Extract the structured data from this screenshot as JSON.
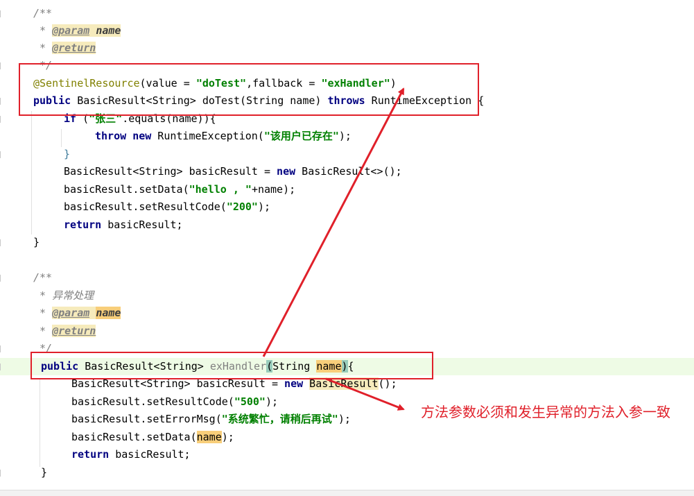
{
  "editor": {
    "lines": {
      "l1": {
        "a": "/**"
      },
      "l2": {
        "a": " * ",
        "tag": "@param",
        "sp": " ",
        "name": "name"
      },
      "l3": {
        "a": " * ",
        "tag": "@return"
      },
      "l4": {
        "a": " */"
      },
      "l5": {
        "ann": "@SentinelResource",
        "p1": "(value = ",
        "s1": "\"doTest\"",
        "p2": ",fallback = ",
        "s2": "\"exHandler\"",
        "p3": ")"
      },
      "l6": {
        "k1": "public",
        "t1": " BasicResult<String> doTest(String name) ",
        "k2": "throws",
        "t2": " RuntimeException {"
      },
      "l7": {
        "k1": "if",
        "t1": " (",
        "s1": "\"张三\"",
        "t2": ".equals(name)){"
      },
      "l8": {
        "k1": "throw",
        "sp": " ",
        "k2": "new",
        "t1": " RuntimeException(",
        "s1": "\"该用户已存在\"",
        "t2": ");"
      },
      "l9": {
        "t1": "}"
      },
      "l10": {
        "t1": "BasicResult<String> basicResult = ",
        "k1": "new",
        "t2": " BasicResult<>();"
      },
      "l11": {
        "t1": "basicResult.setData(",
        "s1": "\"hello , \"",
        "t2": "+name);"
      },
      "l12": {
        "t1": "basicResult.setResultCode(",
        "s1": "\"200\"",
        "t2": ");"
      },
      "l13": {
        "k1": "return",
        "t1": " basicResult;"
      },
      "l14": {
        "t1": "}"
      },
      "l16": {
        "a": "/**"
      },
      "l17": {
        "a": " * 异常处理"
      },
      "l18": {
        "a": " * ",
        "tag": "@param",
        "sp": " ",
        "name": "name"
      },
      "l19": {
        "a": " * ",
        "tag": "@return"
      },
      "l20": {
        "a": " */"
      },
      "l21": {
        "k1": "public",
        "t1": " BasicResult<String> ",
        "fn": "exHandler",
        "b1": "(",
        "t2": "String ",
        "p": "name",
        "b2": ")",
        "t3": "{"
      },
      "l22": {
        "t1": "BasicResult<String> basicResult = ",
        "k1": "new",
        "sp": " ",
        "t2": "BasicResult",
        "t3": "();"
      },
      "l23": {
        "t1": "basicResult.setResultCode(",
        "s1": "\"500\"",
        "t2": ");"
      },
      "l24": {
        "t1": "basicResult.setErrorMsg(",
        "s1": "\"系统繁忙，请稍后再试\"",
        "t2": ");"
      },
      "l25": {
        "t1": "basicResult.setData(",
        "p": "name",
        "t2": ");"
      },
      "l26": {
        "k1": "return",
        "t1": " basicResult;"
      },
      "l27": {
        "t1": "}"
      }
    }
  },
  "annotation": {
    "note": "方法参数必须和发生异常的方法入参一致",
    "color": "#e0202a"
  }
}
